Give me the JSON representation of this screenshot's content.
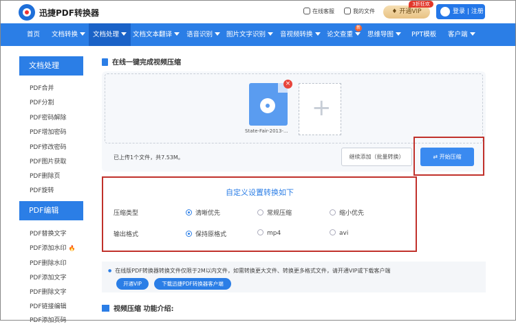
{
  "header": {
    "brand": "迅捷PDF转换器",
    "service": "在线客服",
    "my_files": "我的文件",
    "vip": "开通VIP",
    "vip_badge": "3折狂欢",
    "login": "登录 | 注册"
  },
  "nav": {
    "items": [
      "首页",
      "文档转换",
      "文档处理",
      "文档文本翻译",
      "语音识别",
      "图片文字识别",
      "音视频转换",
      "论文查重",
      "思维导图",
      "PPT模板",
      "客户端"
    ],
    "active": "文档处理",
    "new_badge": "新"
  },
  "sidebar": {
    "group1_title": "文档处理",
    "group1_items": [
      "PDF合并",
      "PDF分割",
      "PDF密码解除",
      "PDF增加密码",
      "PDF修改密码",
      "PDF图片获取",
      "PDF删除页",
      "PDF旋转"
    ],
    "group2_title": "PDF编辑",
    "group2_items": [
      "PDF替换文字",
      "PDF添加水印",
      "PDF删除水印",
      "PDF添加文字",
      "PDF删除文字",
      "PDF链接编辑",
      "PDF添加页码"
    ]
  },
  "main": {
    "section_title": "在线一键完成视频压缩",
    "file_name": "State-Fair-2013-...",
    "upload_info": "已上传1个文件，共7.53M。",
    "continue_button": "继续添加（批量转换）",
    "start_button": "开始压缩",
    "options_title": "自定义设置转换如下",
    "compress_label": "压缩类型",
    "compress_options": [
      "清晰优先",
      "常规压缩",
      "缩小优先"
    ],
    "compress_selected": "清晰优先",
    "format_label": "输出格式",
    "format_options": [
      "保持原格式",
      "mp4",
      "avi"
    ],
    "format_selected": "保持原格式",
    "notice": "在线版PDF转换器转换文件仅限于2M以内文件，如需转换更大文件、转换更多格式文件，请开通VIP或下载客户端",
    "notice_vip_button": "开通VIP",
    "notice_download_button": "下载迅捷PDF转换器客户端",
    "intro_title": "视频压缩 功能介绍:"
  },
  "colors": {
    "primary": "#2b7ee6",
    "nav_active": "#1a62c7",
    "highlight_red": "#c0302a",
    "vip_gold": "#e8c283"
  }
}
